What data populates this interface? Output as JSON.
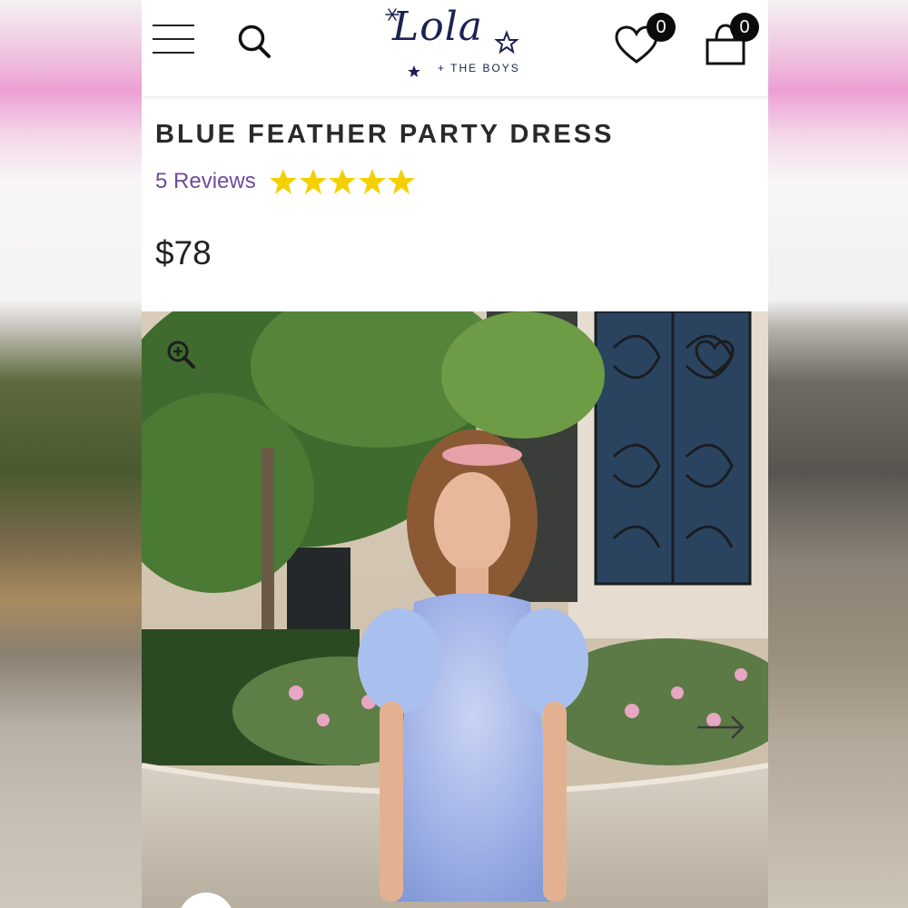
{
  "header": {
    "logo_text": "Lola",
    "logo_subtext": "+ THE BOYS",
    "wishlist_count": "0",
    "cart_count": "0"
  },
  "product": {
    "title": "BLUE FEATHER PARTY DRESS",
    "reviews_label": "5 Reviews",
    "rating": 5,
    "rating_max": 5,
    "price": "$78"
  },
  "icons": {
    "menu": "hamburger-icon",
    "search": "search-icon",
    "wishlist": "heart-icon",
    "cart": "shopping-bag-icon",
    "zoom": "zoom-in-icon",
    "image_wishlist": "heart-outline-icon",
    "next": "arrow-right-icon"
  },
  "colors": {
    "brand_navy": "#1c2250",
    "reviews_purple": "#6f4a9a",
    "star_yellow": "#f5d000",
    "badge_black": "#0b0b0b"
  }
}
